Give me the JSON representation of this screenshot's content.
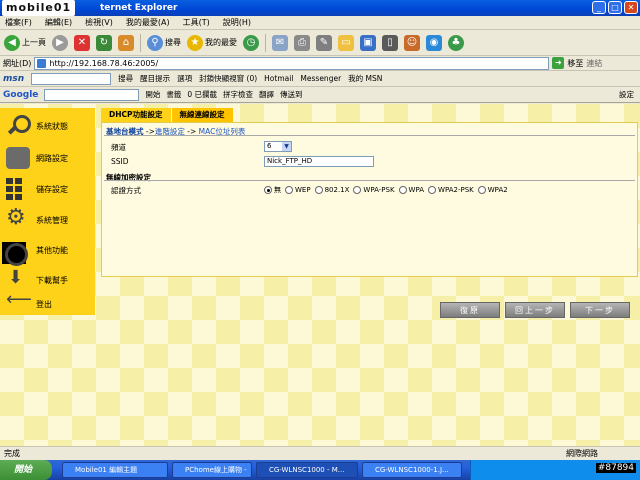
{
  "window": {
    "logo": "mobile01",
    "title": "ternet Explorer"
  },
  "menu": [
    "檔案(F)",
    "編輯(E)",
    "檢視(V)",
    "我的最愛(A)",
    "工具(T)",
    "說明(H)"
  ],
  "toolbar": {
    "back": "上一頁",
    "search": "搜尋",
    "favorites": "我的最愛"
  },
  "address": {
    "label": "網址(D)",
    "url": "http://192.168.78.46:2005/",
    "go": "移至",
    "links": "連結"
  },
  "msnbar": {
    "logo": "msn",
    "search": "搜尋",
    "highlight": "醒目提示",
    "options": "選項",
    "popups": "封鎖快顯視窗 (0)",
    "hotmail": "Hotmail",
    "messenger": "Messenger",
    "mymsn": "我的 MSN"
  },
  "googlebar": {
    "logo": "Google",
    "go": "開始",
    "bookmarks": "書籤",
    "blocked": "0 已攔截",
    "spell": "拼字檢查",
    "translate": "翻譯",
    "sendto": "傳送到",
    "settings": "設定"
  },
  "sidebar": {
    "items": [
      "系統狀態",
      "網路設定",
      "儲存設定",
      "系統管理",
      "其他功能",
      "下載幫手",
      "登出"
    ]
  },
  "tabs": [
    "DHCP功能設定",
    "無線連線設定"
  ],
  "breadcrumb": {
    "current": "基地台模式",
    "sep1": " ->",
    "link1": "進階設定",
    "sep2": " -> ",
    "link2": "MAC位址列表"
  },
  "form": {
    "channel_label": "頻道",
    "channel_value": "6",
    "ssid_label": "SSID",
    "ssid_value": "Nick_FTP_HD",
    "security_section": "無線加密設定",
    "auth_label": "認證方式",
    "auth_options": [
      "無",
      "WEP",
      "802.1X",
      "WPA-PSK",
      "WPA",
      "WPA2-PSK",
      "WPA2"
    ]
  },
  "buttons": {
    "restore": "復原",
    "prev": "回上一步",
    "next": "下一步"
  },
  "status": {
    "left": "完成",
    "zone": "網際網路"
  },
  "taskbar": {
    "start": "開始",
    "tasks": [
      "Mobile01 編輯主題",
      "PChome線上購物 -",
      "CG-WLNSC1000 - M...",
      "CG-WLNSC1000-1.J..."
    ],
    "clock": "#87894"
  }
}
